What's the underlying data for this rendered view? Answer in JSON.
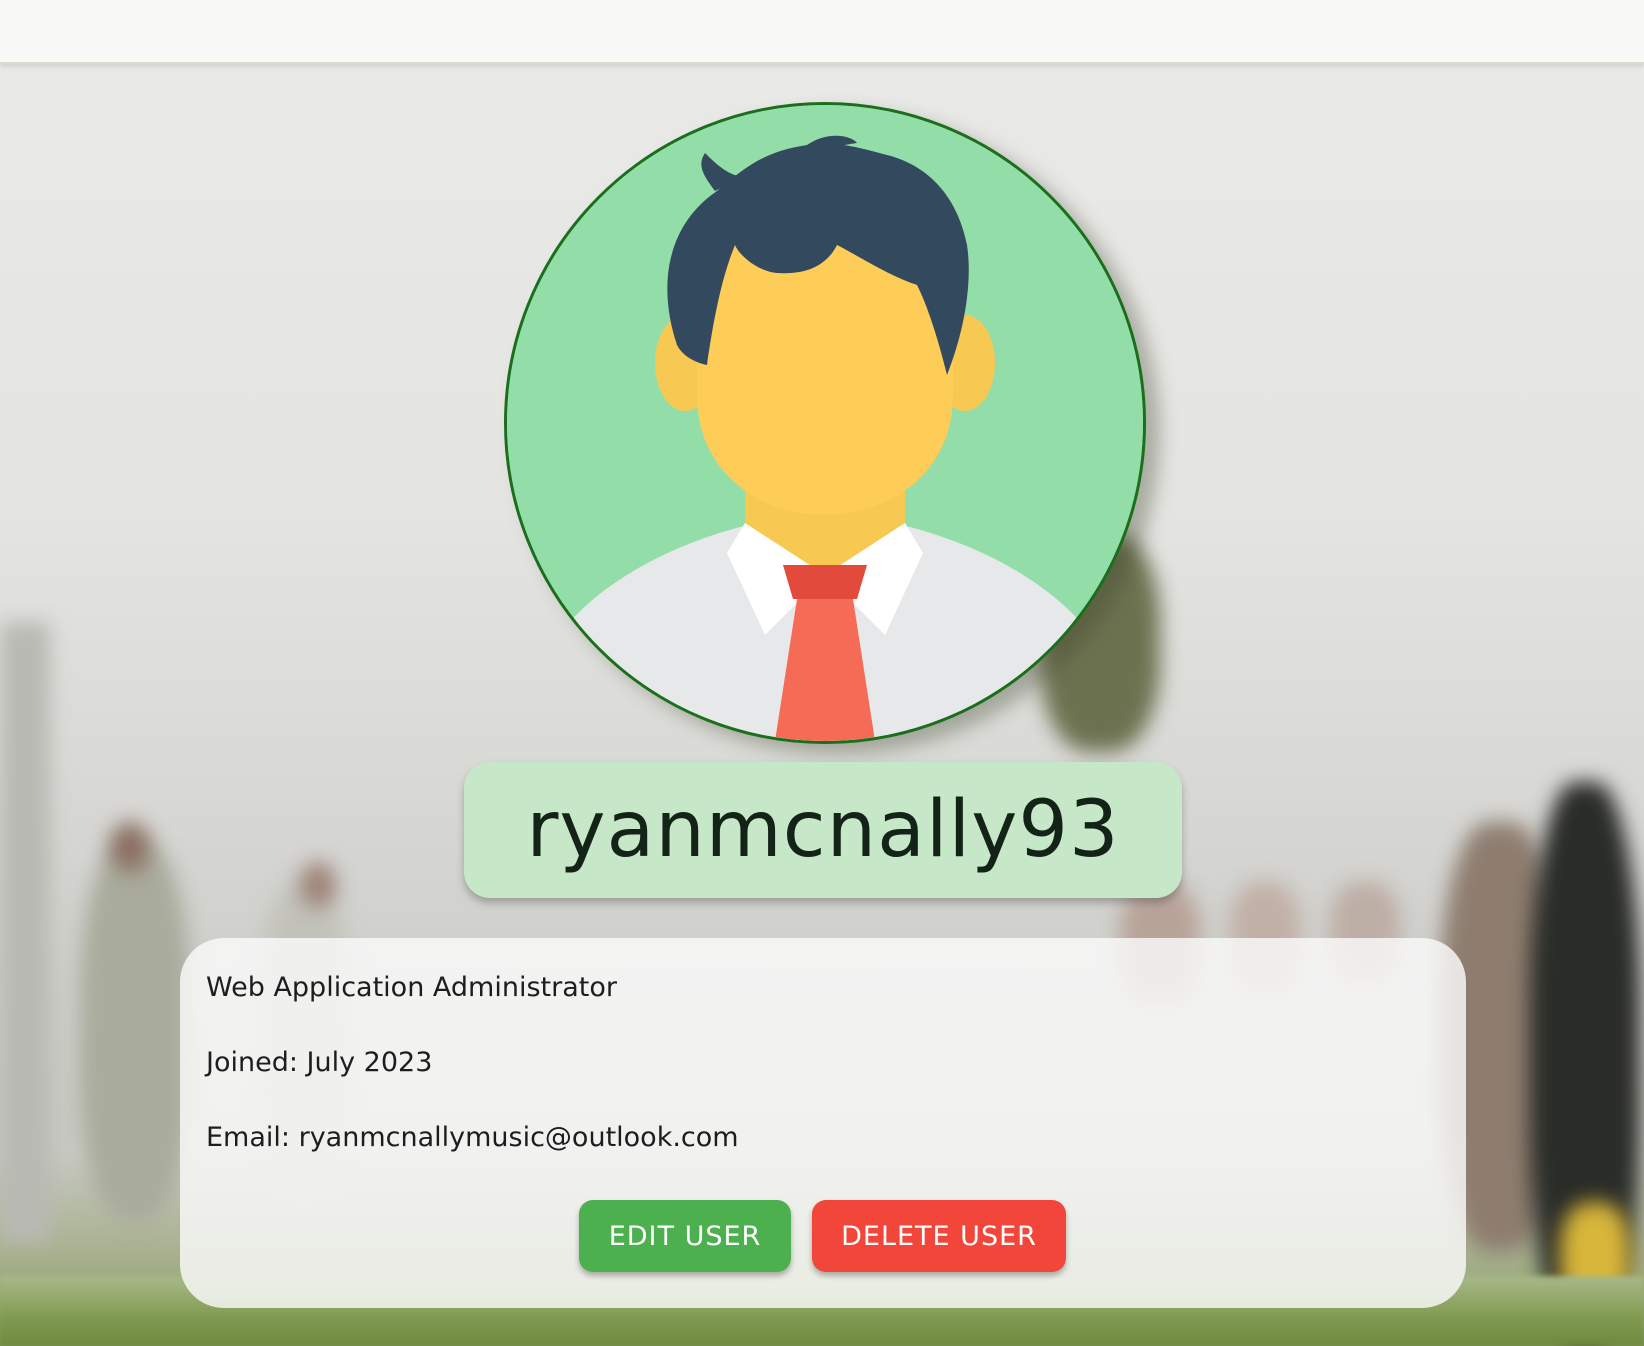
{
  "profile": {
    "username": "ryanmcnally93",
    "role": "Web Application Administrator",
    "joined": "Joined: July 2023",
    "email": "Email: ryanmcnallymusic@outlook.com"
  },
  "actions": {
    "edit_label": "EDIT USER",
    "delete_label": "DELETE USER"
  },
  "colors": {
    "avatar_bg": "#93dea8",
    "avatar_border": "#1b6e1b",
    "username_pill": "#c7e8c8",
    "edit_button": "#4cb04f",
    "delete_button": "#f2463a"
  },
  "icons": {
    "avatar": "person-with-tie-icon"
  }
}
